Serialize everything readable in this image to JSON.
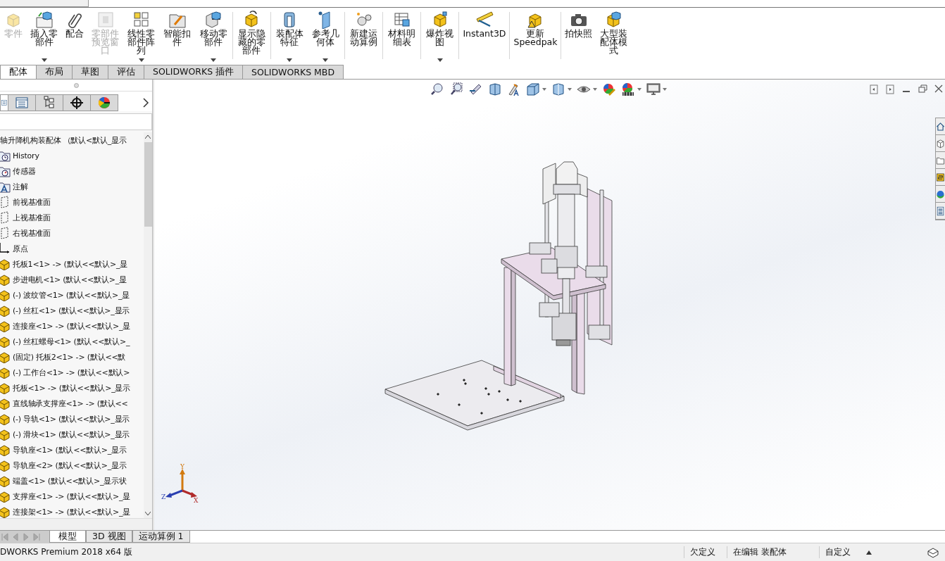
{
  "ribbon": {
    "groups": [
      [
        {
          "kind": "part",
          "label": "零件",
          "disabled": true,
          "menu": false
        },
        {
          "kind": "insert",
          "label": "插入零部件",
          "disabled": false,
          "menu": true
        },
        {
          "kind": "mate",
          "label": "配合",
          "disabled": false,
          "menu": false
        },
        {
          "kind": "preview",
          "label": "零部件预览窗口",
          "disabled": true,
          "menu": false
        },
        {
          "kind": "pattern",
          "label": "线性零部件阵列",
          "disabled": false,
          "menu": true
        },
        {
          "kind": "fastener",
          "label": "智能扣件",
          "disabled": false,
          "menu": false
        },
        {
          "kind": "move",
          "label": "移动零部件",
          "disabled": false,
          "menu": true
        }
      ],
      [
        {
          "kind": "show",
          "label": "显示隐藏的零部件",
          "disabled": false,
          "menu": false
        }
      ],
      [
        {
          "kind": "feature",
          "label": "装配体特征",
          "disabled": false,
          "menu": true
        },
        {
          "kind": "reference",
          "label": "参考几何体",
          "disabled": false,
          "menu": true
        }
      ],
      [
        {
          "kind": "motion",
          "label": "新建运动算例",
          "disabled": false,
          "menu": false
        }
      ],
      [
        {
          "kind": "bom",
          "label": "材料明细表",
          "disabled": false,
          "menu": false
        }
      ],
      [
        {
          "kind": "explode",
          "label": "爆炸视图",
          "disabled": false,
          "menu": true
        }
      ],
      [
        {
          "kind": "ruler",
          "label": "Instant3D",
          "disabled": false,
          "menu": false
        }
      ],
      [
        {
          "kind": "speedpak",
          "label": "更新 Speedpak",
          "disabled": false,
          "menu": false
        }
      ],
      [
        {
          "kind": "camera",
          "label": "拍快照",
          "disabled": false,
          "menu": false
        },
        {
          "kind": "large",
          "label": "大型装配体模式",
          "disabled": false,
          "menu": false
        }
      ]
    ]
  },
  "tabs": [
    {
      "label": "配体",
      "selected": true
    },
    {
      "label": "布局",
      "selected": false
    },
    {
      "label": "草图",
      "selected": false
    },
    {
      "label": "评估",
      "selected": false
    },
    {
      "label": "SOLIDWORKS 插件",
      "selected": false
    },
    {
      "label": "SOLIDWORKS MBD",
      "selected": false
    }
  ],
  "panel_tabs": [
    {
      "kind": "tree",
      "selected": true
    },
    {
      "kind": "property",
      "selected": false
    },
    {
      "kind": "config",
      "selected": false
    },
    {
      "kind": "target",
      "selected": false
    },
    {
      "kind": "display",
      "selected": false
    }
  ],
  "tree": {
    "label": "轴升降机构装配体 （默认<默认_显示",
    "children": [
      {
        "kind": "history",
        "label": "History"
      },
      {
        "kind": "sensor",
        "label": "传感器"
      },
      {
        "kind": "annotation",
        "label": "注解"
      },
      {
        "kind": "plane",
        "label": "前视基准面"
      },
      {
        "kind": "plane",
        "label": "上视基准面"
      },
      {
        "kind": "plane",
        "label": "右视基准面"
      },
      {
        "kind": "origin",
        "label": "原点"
      },
      {
        "kind": "part",
        "label": "托板1<1> -> (默认<<默认>_显"
      },
      {
        "kind": "part",
        "label": "步进电机<1> (默认<<默认>_显"
      },
      {
        "kind": "part",
        "label": "(-) 波纹管<1> (默认<<默认>_显"
      },
      {
        "kind": "part",
        "label": "(-) 丝杠<1> (默认<<默认>_显示"
      },
      {
        "kind": "part",
        "label": "连接座<1> -> (默认<<默认>_显"
      },
      {
        "kind": "part",
        "label": "(-) 丝杠螺母<1> (默认<<默认>_"
      },
      {
        "kind": "part",
        "label": "(固定) 托板2<1> -> (默认<<默"
      },
      {
        "kind": "part",
        "label": "(-) 工作台<1> -> (默认<<默认>"
      },
      {
        "kind": "part",
        "label": "托板<1> -> (默认<<默认>_显示"
      },
      {
        "kind": "part",
        "label": "直线轴承支撑座<1> -> (默认<<"
      },
      {
        "kind": "part",
        "label": "(-) 导轨<1> (默认<<默认>_显示"
      },
      {
        "kind": "part",
        "label": "(-) 滑块<1> (默认<<默认>_显示"
      },
      {
        "kind": "part",
        "label": "导轨座<1> (默认<<默认>_显示"
      },
      {
        "kind": "part",
        "label": "导轨座<2> (默认<<默认>_显示"
      },
      {
        "kind": "part",
        "label": "端盖<1> (默认<<默认>_显示状"
      },
      {
        "kind": "part",
        "label": "支撑座<1> -> (默认<<默认>_显"
      },
      {
        "kind": "part",
        "label": "连接架<1> -> (默认<<默认>_显"
      }
    ]
  },
  "triad": {
    "y": "Y",
    "z": "Z",
    "x": "X"
  },
  "bottom_tabs": [
    {
      "label": "模型",
      "selected": true
    },
    {
      "label": "3D 视图",
      "selected": false
    },
    {
      "label": "运动算例 1",
      "selected": false
    }
  ],
  "status_bar": {
    "product": "DWORKS Premium 2018 x64 版",
    "items": [
      "欠定义",
      "在编辑 装配体",
      "自定义"
    ]
  }
}
